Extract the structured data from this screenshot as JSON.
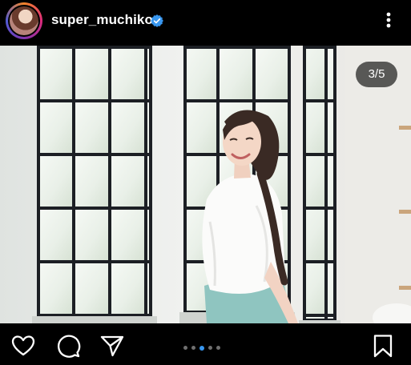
{
  "header": {
    "username": "super_muchiko",
    "verified_icon": "verified-badge-icon",
    "more_icon": "more-vertical-icon"
  },
  "post": {
    "image_counter": "3/5",
    "current_index": 3,
    "total_images": 5
  },
  "actions": {
    "like_icon": "heart-icon",
    "comment_icon": "comment-icon",
    "share_icon": "send-icon",
    "save_icon": "bookmark-icon"
  },
  "colors": {
    "background": "#000000",
    "accent": "#3897f0",
    "verified": "#3897f0"
  }
}
